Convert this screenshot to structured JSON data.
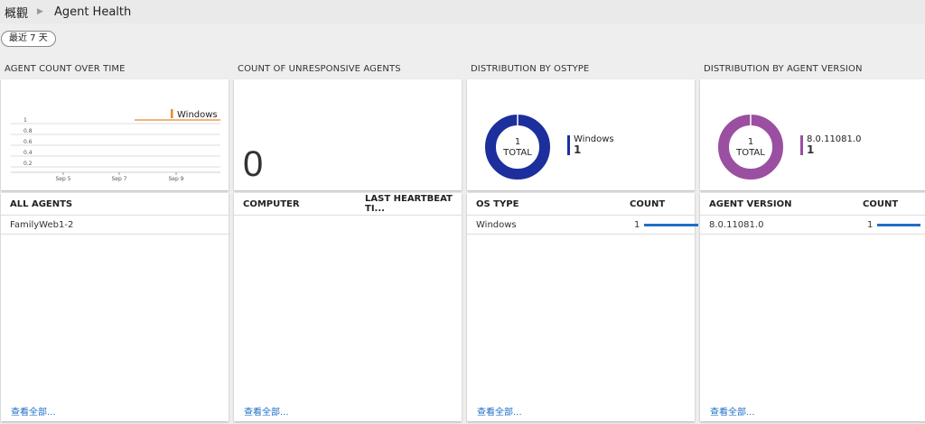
{
  "breadcrumb": {
    "root": "概觀",
    "current": "Agent Health"
  },
  "range_button": "最近 7 天",
  "sections": {
    "agent_count": "AGENT COUNT OVER TIME",
    "unresponsive": "COUNT OF UNRESPONSIVE AGENTS",
    "ostype": "DISTRIBUTION BY OSTYPE",
    "version": "DISTRIBUTION BY AGENT VERSION"
  },
  "chart_data": {
    "type": "line",
    "x": [
      "Sep 5",
      "Sep 7",
      "Sep 9"
    ],
    "series": [
      {
        "name": "Windows",
        "color": "#e8892c",
        "values": [
          1
        ]
      }
    ],
    "yticks": [
      "1",
      "0.8",
      "0.6",
      "0.4",
      "0.2"
    ],
    "ylim": [
      0,
      1
    ],
    "legend": "top-right"
  },
  "unresponsive_count": "0",
  "ostype_donut": {
    "total": "1",
    "total_label": "TOTAL",
    "legend_name": "Windows",
    "legend_value": "1",
    "color": "#1c2f9c"
  },
  "version_donut": {
    "total": "1",
    "total_label": "TOTAL",
    "legend_name": "8.0.11081.0",
    "legend_value": "1",
    "color": "#9b4fa0"
  },
  "all_agents": {
    "header": "ALL AGENTS",
    "rows": [
      "FamilyWeb1-2"
    ],
    "view_all": "查看全部..."
  },
  "unresponsive_list": {
    "col1": "COMPUTER",
    "col2": "LAST HEARTBEAT TI...",
    "view_all": "查看全部..."
  },
  "ostype_list": {
    "col1": "OS TYPE",
    "col2": "COUNT",
    "rows": [
      {
        "name": "Windows",
        "count": "1"
      }
    ],
    "view_all": "查看全部..."
  },
  "version_list": {
    "col1": "AGENT VERSION",
    "col2": "COUNT",
    "rows": [
      {
        "name": "8.0.11081.0",
        "count": "1"
      }
    ],
    "view_all": "查看全部..."
  }
}
